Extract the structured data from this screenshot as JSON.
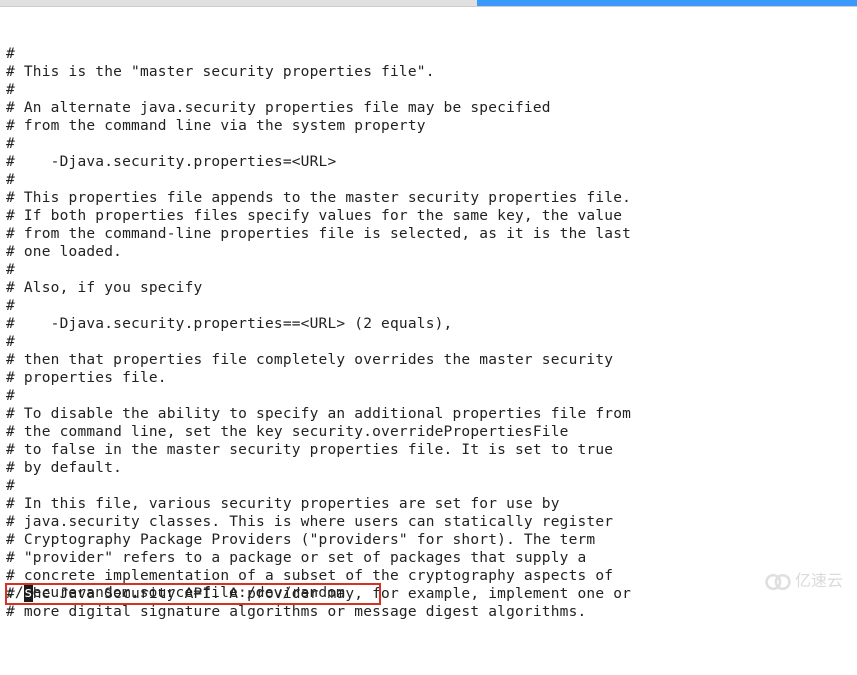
{
  "file": {
    "lines": [
      "#",
      "# This is the \"master security properties file\".",
      "#",
      "# An alternate java.security properties file may be specified",
      "# from the command line via the system property",
      "#",
      "#    -Djava.security.properties=<URL>",
      "#",
      "# This properties file appends to the master security properties file.",
      "# If both properties files specify values for the same key, the value",
      "# from the command-line properties file is selected, as it is the last",
      "# one loaded.",
      "#",
      "# Also, if you specify",
      "#",
      "#    -Djava.security.properties==<URL> (2 equals),",
      "#",
      "# then that properties file completely overrides the master security",
      "# properties file.",
      "#",
      "# To disable the ability to specify an additional properties file from",
      "# the command line, set the key security.overridePropertiesFile",
      "# to false in the master security properties file. It is set to true",
      "# by default.",
      "#",
      "# In this file, various security properties are set for use by",
      "# java.security classes. This is where users can statically register",
      "# Cryptography Package Providers (\"providers\" for short). The term",
      "# \"provider\" refers to a package or set of packages that supply a",
      "# concrete implementation of a subset of the cryptography aspects of",
      "# the Java Security API. A provider may, for example, implement one or",
      "# more digital signature algorithms or message digest algorithms."
    ]
  },
  "command": {
    "prefix": ":/",
    "cursor_char": "s",
    "query": "ecurerandom.source=file:/dev/random"
  },
  "watermark": {
    "text": "亿速云"
  },
  "highlight": {
    "border_color": "#d93025"
  }
}
